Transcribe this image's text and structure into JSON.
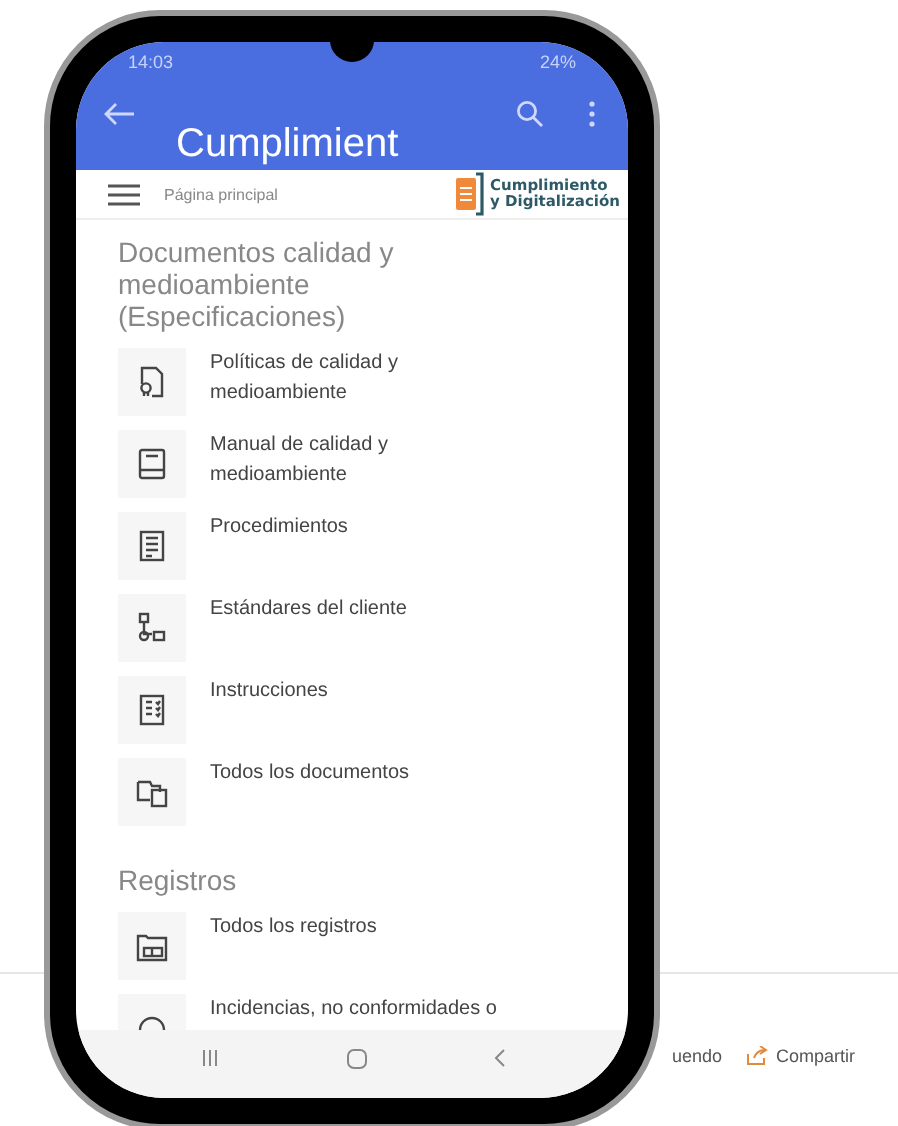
{
  "page_footer": {
    "partial_link": "uendo",
    "share_link": "Compartir"
  },
  "phone": {
    "status_bar": {
      "time": "14:03",
      "battery": "24%"
    },
    "app_bar": {
      "title": "Cumplimient"
    },
    "nav_bar": {
      "page_label": "Página principal",
      "logo_line_1": "Cumplimiento",
      "logo_line_2": "y Digitalización"
    },
    "sections": [
      {
        "heading": "Documentos calidad y medioambiente (Especificaciones)",
        "items": [
          {
            "label": "Políticas de calidad y medioambiente"
          },
          {
            "label": "Manual de calidad y medioambiente"
          },
          {
            "label": "Procedimientos"
          },
          {
            "label": "Estándares del cliente"
          },
          {
            "label": "Instrucciones"
          },
          {
            "label": "Todos los documentos"
          }
        ]
      },
      {
        "heading": "Registros",
        "items": [
          {
            "label": "Todos los registros"
          },
          {
            "label": "Incidencias, no conformidades o"
          }
        ]
      }
    ]
  }
}
